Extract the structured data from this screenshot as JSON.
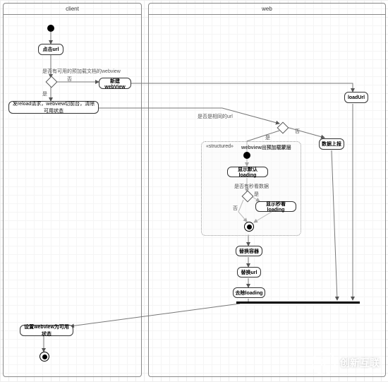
{
  "swimlanes": {
    "client": {
      "label": "client"
    },
    "web": {
      "label": "web"
    }
  },
  "nodes": {
    "click_url": "点击url",
    "new_webview": "新建webView",
    "reload_reset": "发reload请求，webview切前台，清除可用状态",
    "load_url": "loadUrl",
    "report": "数据上报",
    "show_default": "显示默认loading",
    "show_fast": "显示秒看loading",
    "replace_container": "替换容器",
    "replace_url": "替换url",
    "remove_loading": "去除loading",
    "set_available": "设置webview为可用状态"
  },
  "decisions": {
    "has_preload_doc": "是否有可用的预加载文档的webview",
    "same_url": "是否是相同的url",
    "has_fast_data": "是否有秒看数据"
  },
  "branches": {
    "yes": "是",
    "no": "否"
  },
  "structured": {
    "tag": "«structured»",
    "title": "webview出预加载蒙层"
  },
  "watermark": "创新互联"
}
